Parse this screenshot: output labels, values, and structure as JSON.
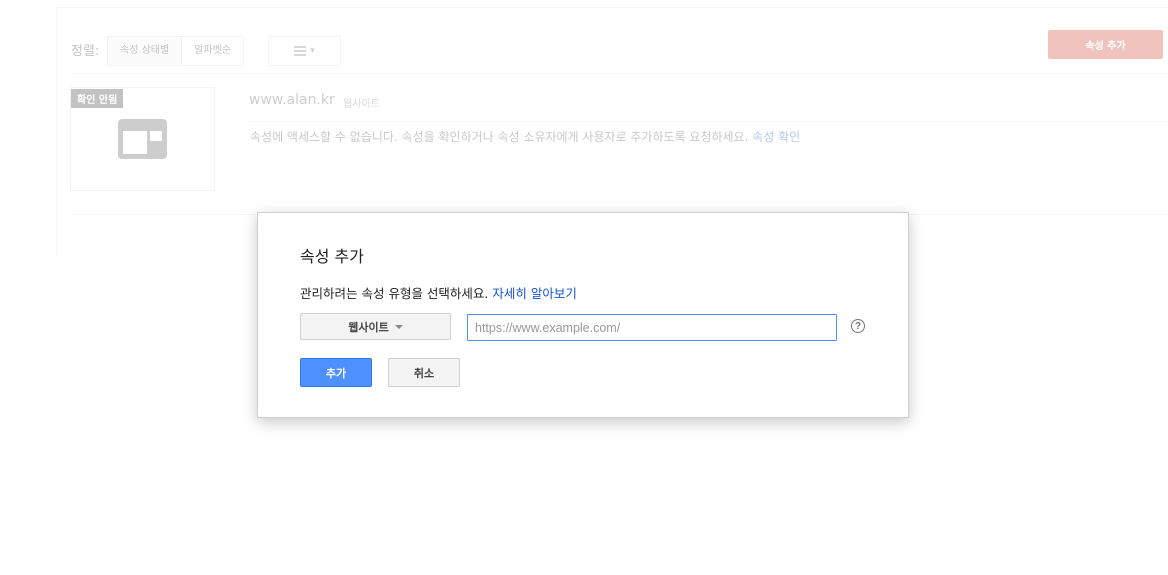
{
  "background": {
    "sort": {
      "label": "정렬:",
      "options": [
        "속성 상태별",
        "알파벳순"
      ]
    },
    "add_property_button": "속성 추가",
    "property": {
      "badge": "확인 안됨",
      "url": "www.alan.kr",
      "type": "웹사이트",
      "message": "속성에 액세스할 수 없습니다. 속성을 확인하거나 속성 소유자에게 사용자로 추가하도록 요청하세요.",
      "verify_link": "속성 확인"
    }
  },
  "dialog": {
    "title": "속성 추가",
    "description": "관리하려는 속성 유형을 선택하세요.",
    "learn_more": "자세히 알아보기",
    "type_select": "웹사이트",
    "url_placeholder": "https://www.example.com/",
    "url_value": "",
    "help_icon": "?",
    "add_button": "추가",
    "cancel_button": "취소"
  },
  "colors": {
    "primary_blue": "#4d90fe",
    "link_blue": "#1155cc",
    "red_action": "#d14836"
  }
}
